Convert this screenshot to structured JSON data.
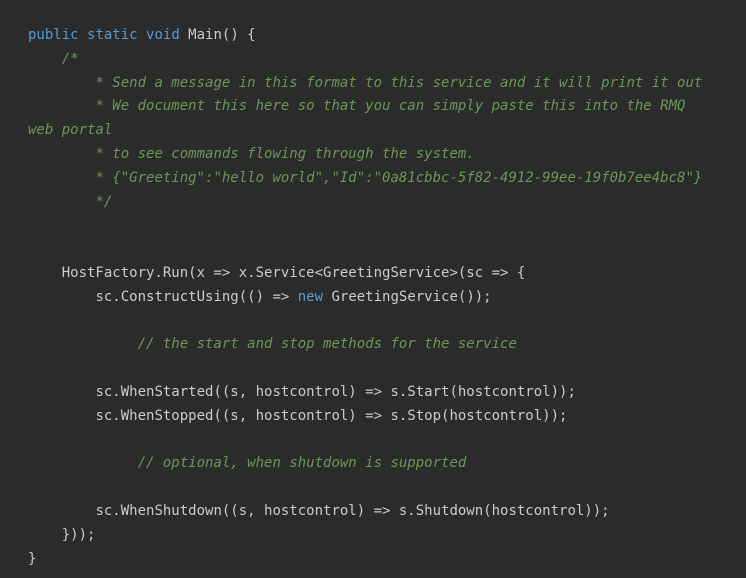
{
  "code": {
    "line1_kw1": "public",
    "line1_kw2": "static",
    "line1_kw3": "void",
    "line1_rest": " Main() {",
    "line2": "    /*",
    "line3": "        * Send a message in this format to this service and it will print it out",
    "line4": "        * We document this here so that you can simply paste this into the RMQ web portal",
    "line5": "        * to see commands flowing through the system.",
    "line6": "        * {\"Greeting\":\"hello world\",\"Id\":\"0a81cbbc-5f82-4912-99ee-19f0b7ee4bc8\"}",
    "line7": "        */",
    "blank": "",
    "line8a": "    HostFactory.Run(x => x.Service<GreetingService>(sc => {",
    "line9a": "        sc.ConstructUsing(() => ",
    "line9_new": "new",
    "line9b": " GreetingService());",
    "line10": "             // the start and stop methods for the service",
    "line11": "        sc.WhenStarted((s, hostcontrol) => s.Start(hostcontrol));",
    "line12": "        sc.WhenStopped((s, hostcontrol) => s.Stop(hostcontrol));",
    "line13": "             // optional, when shutdown is supported",
    "line14": "        sc.WhenShutdown((s, hostcontrol) => s.Shutdown(hostcontrol));",
    "line15": "    }));",
    "line16": "}"
  }
}
